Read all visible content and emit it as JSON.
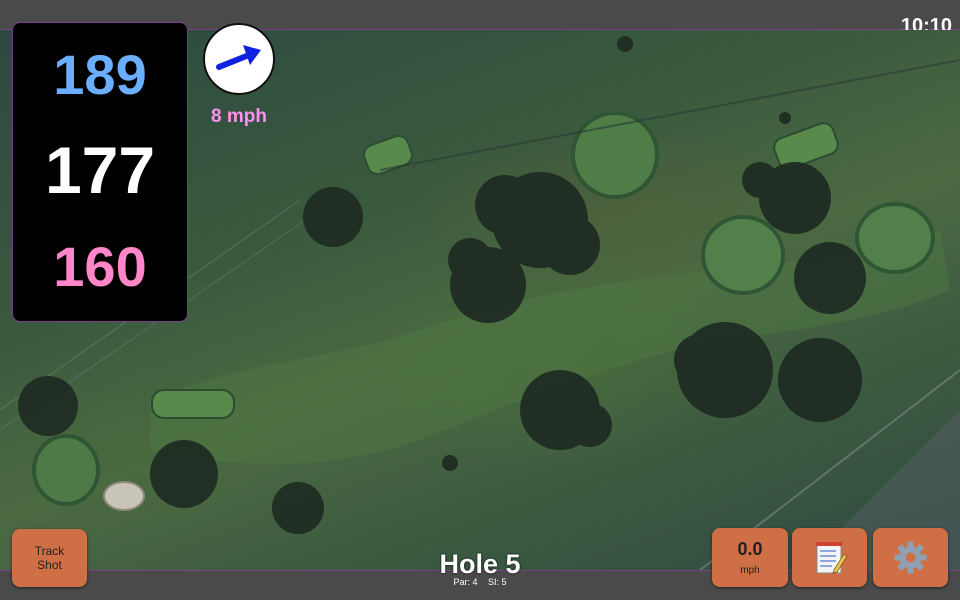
{
  "status": {
    "time": "10:10"
  },
  "distances": {
    "back": "189",
    "middle": "177",
    "front": "160"
  },
  "wind": {
    "speed": "8 mph",
    "icon": "wind-arrow-icon"
  },
  "hole": {
    "title": "Hole 5",
    "par": "Par: 4",
    "stroke_index": "SI: 5"
  },
  "buttons": {
    "track_shot": [
      "Track",
      "Shot"
    ],
    "speed_value": "0.0",
    "speed_unit": "mph",
    "notes_icon": "notepad-icon",
    "settings_icon": "gear-icon"
  },
  "colors": {
    "back_distance": "#6aaeff",
    "middle_distance": "#ffffff",
    "front_distance": "#ff86c8",
    "wind_text": "#ff8ff0",
    "button": "#cf6f45",
    "accent_border": "#7a3d8a"
  }
}
